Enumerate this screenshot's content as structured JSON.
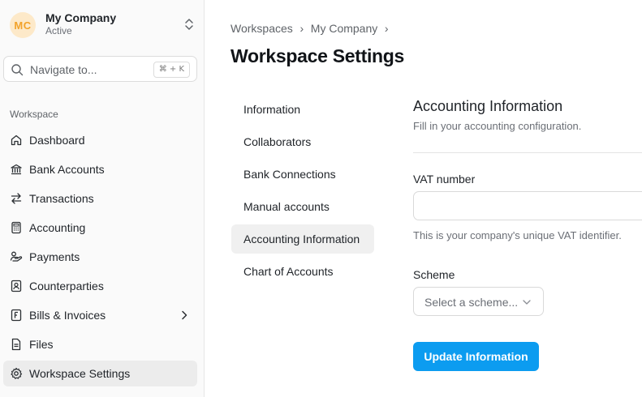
{
  "company": {
    "initials": "MC",
    "name": "My Company",
    "status": "Active"
  },
  "search": {
    "placeholder": "Navigate to...",
    "shortcut": "⌘ + K"
  },
  "sidebar": {
    "section_label": "Workspace",
    "items": [
      {
        "label": "Dashboard",
        "icon": "home-icon"
      },
      {
        "label": "Bank Accounts",
        "icon": "bank-icon"
      },
      {
        "label": "Transactions",
        "icon": "transfer-arrows-icon"
      },
      {
        "label": "Accounting",
        "icon": "calculator-icon"
      },
      {
        "label": "Payments",
        "icon": "payments-icon"
      },
      {
        "label": "Counterparties",
        "icon": "contact-card-icon"
      },
      {
        "label": "Bills & Invoices",
        "icon": "invoice-icon"
      },
      {
        "label": "Files",
        "icon": "file-icon"
      },
      {
        "label": "Workspace Settings",
        "icon": "gear-icon",
        "active": true
      }
    ]
  },
  "breadcrumb": [
    "Workspaces",
    "My Company"
  ],
  "page_title": "Workspace Settings",
  "settings_nav": [
    {
      "label": "Information"
    },
    {
      "label": "Collaborators"
    },
    {
      "label": "Bank Connections"
    },
    {
      "label": "Manual accounts"
    },
    {
      "label": "Accounting Information",
      "active": true
    },
    {
      "label": "Chart of Accounts"
    }
  ],
  "form": {
    "title": "Accounting Information",
    "description": "Fill in your accounting configuration.",
    "vat_label": "VAT number",
    "vat_value": "",
    "vat_hint": "This is your company's unique VAT identifier.",
    "scheme_label": "Scheme",
    "scheme_placeholder": "Select a scheme...",
    "submit_label": "Update Information"
  },
  "colors": {
    "accent": "#0c9cf0",
    "avatar_bg": "#fde9c9",
    "avatar_text": "#f2a22a"
  }
}
